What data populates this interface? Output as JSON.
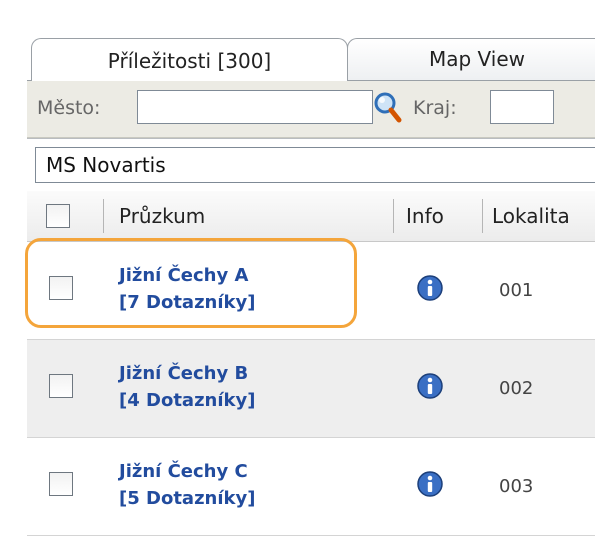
{
  "tabs": [
    {
      "label": "Příležitosti [300]"
    },
    {
      "label": "Map View"
    }
  ],
  "filter": {
    "city_label": "Město:",
    "city_value": "",
    "region_label": "Kraj:",
    "region_value": ""
  },
  "project": {
    "value": "MS Novartis"
  },
  "table": {
    "headers": {
      "survey": "Průzkum",
      "info": "Info",
      "location": "Lokalita"
    },
    "rows": [
      {
        "name_line1": "Jižní Čechy A",
        "name_line2": "[7 Dotazníky]",
        "location": "001"
      },
      {
        "name_line1": "Jižní Čechy B",
        "name_line2": "[4 Dotazníky]",
        "location": "002"
      },
      {
        "name_line1": "Jižní Čechy C",
        "name_line2": "[5 Dotazníky]",
        "location": "003"
      }
    ]
  },
  "colors": {
    "accent_link": "#224c9e",
    "highlight": "#f4a53b"
  },
  "icons": {
    "search": "magnifier-icon",
    "info": "info-icon"
  }
}
